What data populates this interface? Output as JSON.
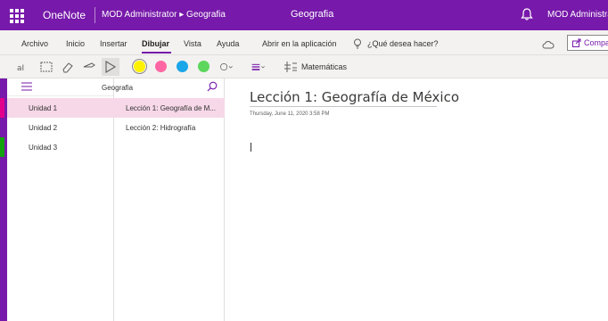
{
  "titlebar": {
    "app_name": "OneNote",
    "breadcrumb": "MOD Administrator ▸ Geografia",
    "notebook_title": "Geografia",
    "user": "MOD Administrator",
    "bg_color": "#7719aa"
  },
  "menu": {
    "items": [
      "Archivo",
      "Inicio",
      "Insertar",
      "Dibujar",
      "Vista",
      "Ayuda",
      "Abrir en la aplicación"
    ],
    "active": "Dibujar",
    "tell_me": "¿Qué desea hacer?",
    "share": "Compartir"
  },
  "toolbar": {
    "icons": [
      "type-ink-icon",
      "lasso-select-icon",
      "eraser-icon",
      "pen-icon",
      "select-arrow-icon"
    ],
    "colors": [
      "#fff200",
      "#ff66a3",
      "#1aa6e8",
      "#5cd65c"
    ],
    "selected_color": "#fff200",
    "math_label": "Matemáticas"
  },
  "sections": {
    "items": [
      {
        "label": "Unidad 1",
        "color": "#e3008c",
        "selected": true
      },
      {
        "label": "Unidad 2",
        "color": "#7719aa",
        "selected": false
      },
      {
        "label": "Unidad 3",
        "color": "#13a10e",
        "selected": false
      }
    ]
  },
  "pages": {
    "notebook_label": "Geografia",
    "items": [
      {
        "label": "Lección 1: Geografía de M...",
        "selected": true
      },
      {
        "label": "Lección 2: Hidrografía",
        "selected": false
      }
    ]
  },
  "page": {
    "title": "Lección 1: Geografía de México",
    "date": "Thursday, June 11, 2020    3:58 PM"
  }
}
